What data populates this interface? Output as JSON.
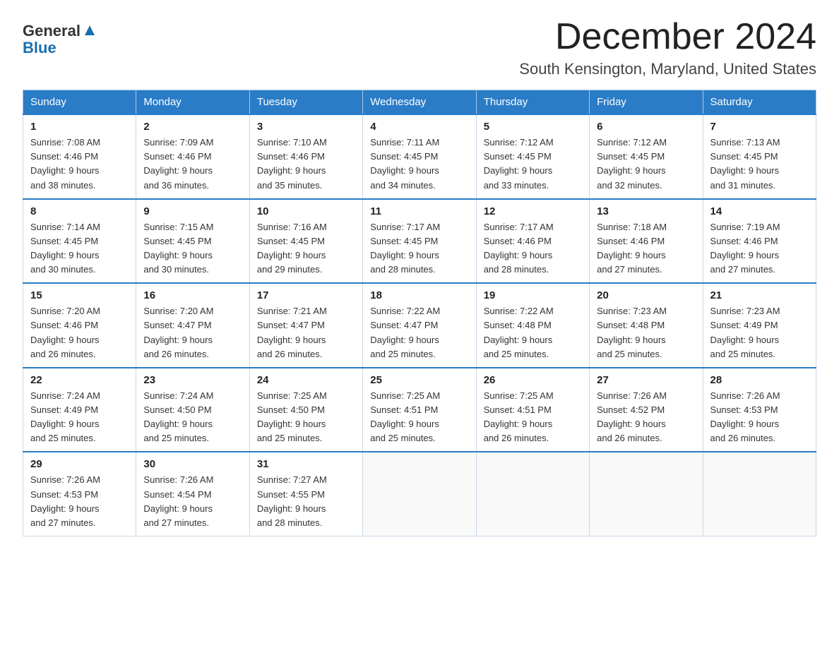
{
  "logo": {
    "text_general": "General",
    "text_blue": "Blue"
  },
  "title": "December 2024",
  "location": "South Kensington, Maryland, United States",
  "days_of_week": [
    "Sunday",
    "Monday",
    "Tuesday",
    "Wednesday",
    "Thursday",
    "Friday",
    "Saturday"
  ],
  "weeks": [
    [
      {
        "num": "1",
        "sunrise": "7:08 AM",
        "sunset": "4:46 PM",
        "daylight": "9 hours and 38 minutes."
      },
      {
        "num": "2",
        "sunrise": "7:09 AM",
        "sunset": "4:46 PM",
        "daylight": "9 hours and 36 minutes."
      },
      {
        "num": "3",
        "sunrise": "7:10 AM",
        "sunset": "4:46 PM",
        "daylight": "9 hours and 35 minutes."
      },
      {
        "num": "4",
        "sunrise": "7:11 AM",
        "sunset": "4:45 PM",
        "daylight": "9 hours and 34 minutes."
      },
      {
        "num": "5",
        "sunrise": "7:12 AM",
        "sunset": "4:45 PM",
        "daylight": "9 hours and 33 minutes."
      },
      {
        "num": "6",
        "sunrise": "7:12 AM",
        "sunset": "4:45 PM",
        "daylight": "9 hours and 32 minutes."
      },
      {
        "num": "7",
        "sunrise": "7:13 AM",
        "sunset": "4:45 PM",
        "daylight": "9 hours and 31 minutes."
      }
    ],
    [
      {
        "num": "8",
        "sunrise": "7:14 AM",
        "sunset": "4:45 PM",
        "daylight": "9 hours and 30 minutes."
      },
      {
        "num": "9",
        "sunrise": "7:15 AM",
        "sunset": "4:45 PM",
        "daylight": "9 hours and 30 minutes."
      },
      {
        "num": "10",
        "sunrise": "7:16 AM",
        "sunset": "4:45 PM",
        "daylight": "9 hours and 29 minutes."
      },
      {
        "num": "11",
        "sunrise": "7:17 AM",
        "sunset": "4:45 PM",
        "daylight": "9 hours and 28 minutes."
      },
      {
        "num": "12",
        "sunrise": "7:17 AM",
        "sunset": "4:46 PM",
        "daylight": "9 hours and 28 minutes."
      },
      {
        "num": "13",
        "sunrise": "7:18 AM",
        "sunset": "4:46 PM",
        "daylight": "9 hours and 27 minutes."
      },
      {
        "num": "14",
        "sunrise": "7:19 AM",
        "sunset": "4:46 PM",
        "daylight": "9 hours and 27 minutes."
      }
    ],
    [
      {
        "num": "15",
        "sunrise": "7:20 AM",
        "sunset": "4:46 PM",
        "daylight": "9 hours and 26 minutes."
      },
      {
        "num": "16",
        "sunrise": "7:20 AM",
        "sunset": "4:47 PM",
        "daylight": "9 hours and 26 minutes."
      },
      {
        "num": "17",
        "sunrise": "7:21 AM",
        "sunset": "4:47 PM",
        "daylight": "9 hours and 26 minutes."
      },
      {
        "num": "18",
        "sunrise": "7:22 AM",
        "sunset": "4:47 PM",
        "daylight": "9 hours and 25 minutes."
      },
      {
        "num": "19",
        "sunrise": "7:22 AM",
        "sunset": "4:48 PM",
        "daylight": "9 hours and 25 minutes."
      },
      {
        "num": "20",
        "sunrise": "7:23 AM",
        "sunset": "4:48 PM",
        "daylight": "9 hours and 25 minutes."
      },
      {
        "num": "21",
        "sunrise": "7:23 AM",
        "sunset": "4:49 PM",
        "daylight": "9 hours and 25 minutes."
      }
    ],
    [
      {
        "num": "22",
        "sunrise": "7:24 AM",
        "sunset": "4:49 PM",
        "daylight": "9 hours and 25 minutes."
      },
      {
        "num": "23",
        "sunrise": "7:24 AM",
        "sunset": "4:50 PM",
        "daylight": "9 hours and 25 minutes."
      },
      {
        "num": "24",
        "sunrise": "7:25 AM",
        "sunset": "4:50 PM",
        "daylight": "9 hours and 25 minutes."
      },
      {
        "num": "25",
        "sunrise": "7:25 AM",
        "sunset": "4:51 PM",
        "daylight": "9 hours and 25 minutes."
      },
      {
        "num": "26",
        "sunrise": "7:25 AM",
        "sunset": "4:51 PM",
        "daylight": "9 hours and 26 minutes."
      },
      {
        "num": "27",
        "sunrise": "7:26 AM",
        "sunset": "4:52 PM",
        "daylight": "9 hours and 26 minutes."
      },
      {
        "num": "28",
        "sunrise": "7:26 AM",
        "sunset": "4:53 PM",
        "daylight": "9 hours and 26 minutes."
      }
    ],
    [
      {
        "num": "29",
        "sunrise": "7:26 AM",
        "sunset": "4:53 PM",
        "daylight": "9 hours and 27 minutes."
      },
      {
        "num": "30",
        "sunrise": "7:26 AM",
        "sunset": "4:54 PM",
        "daylight": "9 hours and 27 minutes."
      },
      {
        "num": "31",
        "sunrise": "7:27 AM",
        "sunset": "4:55 PM",
        "daylight": "9 hours and 28 minutes."
      },
      null,
      null,
      null,
      null
    ]
  ]
}
